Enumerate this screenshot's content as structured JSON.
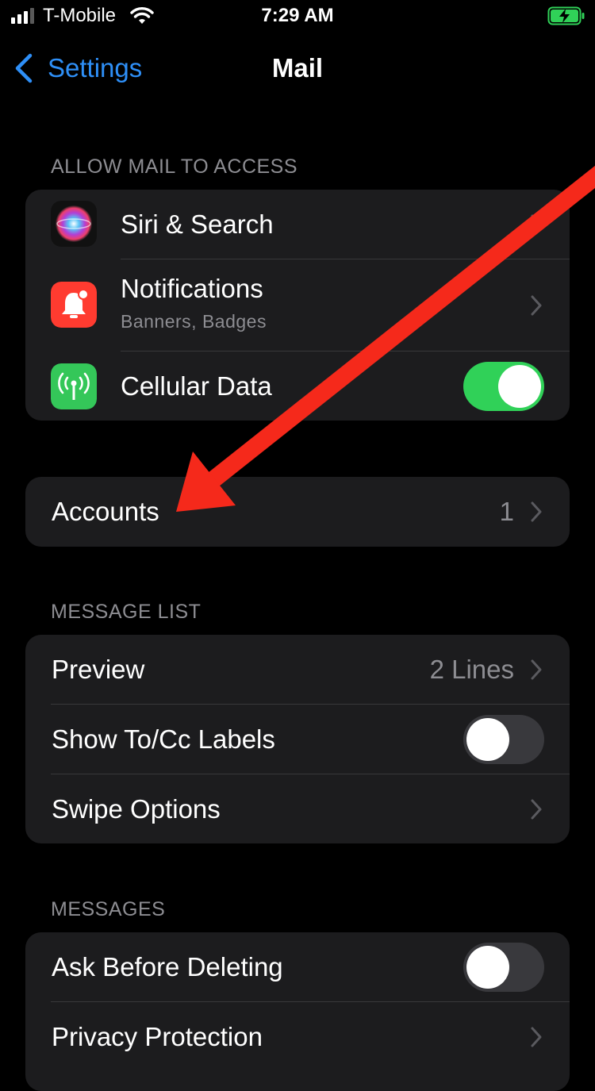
{
  "status_bar": {
    "carrier": "T-Mobile",
    "time": "7:29 AM",
    "signal_bars": 3,
    "battery_charging": true,
    "battery_color": "#30d158"
  },
  "nav": {
    "back_label": "Settings",
    "title": "Mail",
    "accent_color": "#2e8ff7"
  },
  "sections": {
    "allow_access": {
      "header": "ALLOW MAIL TO ACCESS",
      "items": {
        "siri": {
          "label": "Siri & Search",
          "icon": "siri-icon"
        },
        "notifications": {
          "label": "Notifications",
          "sublabel": "Banners, Badges",
          "icon": "bell-icon",
          "icon_color": "#ff3b30"
        },
        "cellular": {
          "label": "Cellular Data",
          "icon": "antenna-icon",
          "icon_color": "#34c759",
          "toggle": true
        }
      }
    },
    "accounts": {
      "label": "Accounts",
      "value": "1"
    },
    "message_list": {
      "header": "MESSAGE LIST",
      "items": {
        "preview": {
          "label": "Preview",
          "value": "2 Lines"
        },
        "to_cc": {
          "label": "Show To/Cc Labels",
          "toggle": false
        },
        "swipe": {
          "label": "Swipe Options"
        }
      }
    },
    "messages": {
      "header": "MESSAGES",
      "items": {
        "ask_delete": {
          "label": "Ask Before Deleting",
          "toggle": false
        },
        "privacy": {
          "label": "Privacy Protection"
        }
      }
    }
  },
  "annotation": {
    "arrow_color": "#f5291b"
  }
}
